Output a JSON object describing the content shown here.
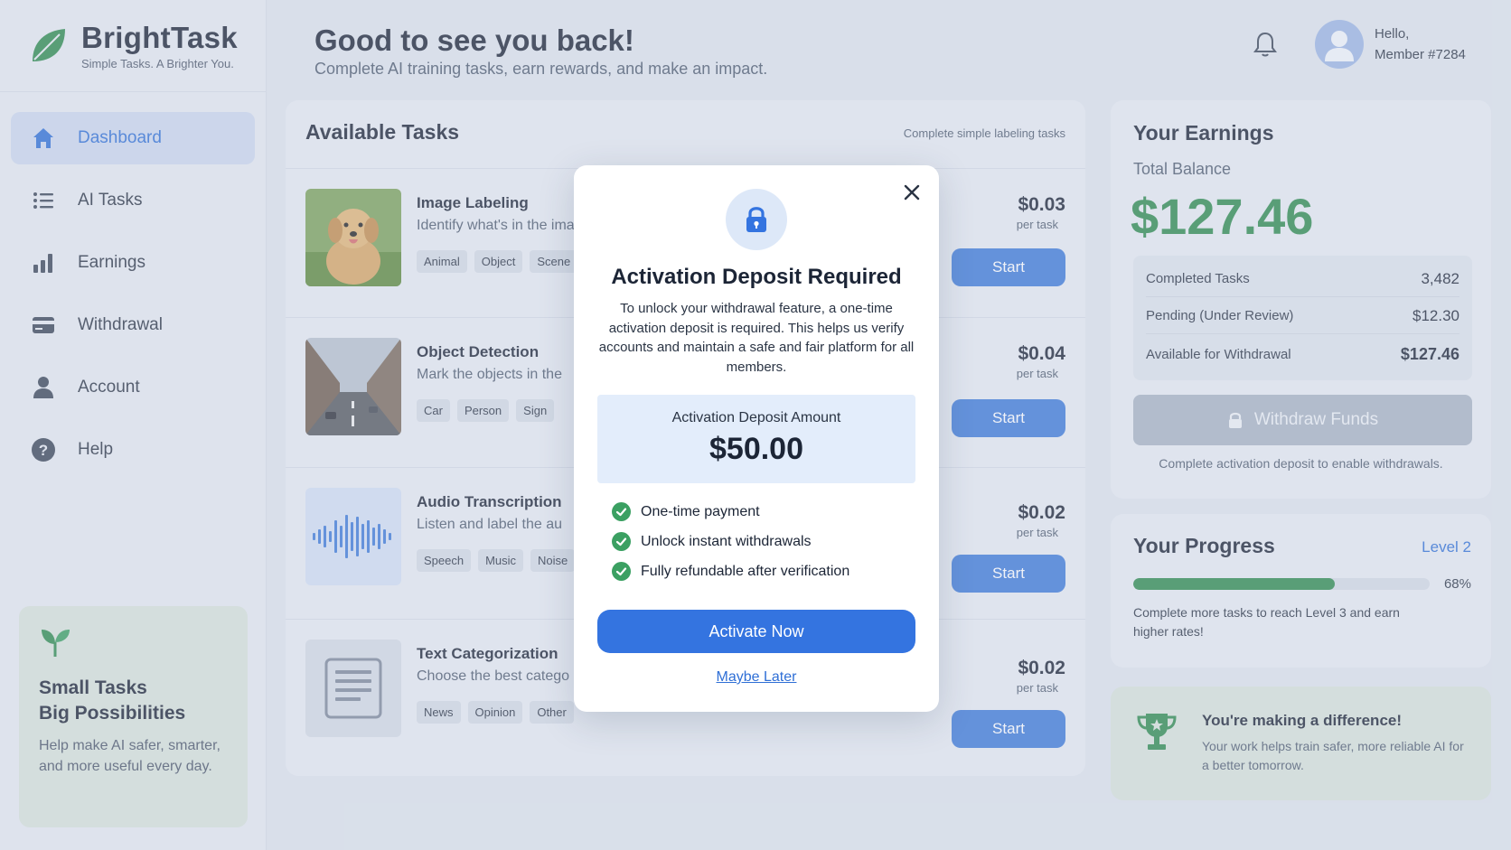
{
  "brand": {
    "name": "BrightTask",
    "tagline": "Simple Tasks. A Brighter You."
  },
  "sidebar": {
    "items": [
      {
        "label": "Dashboard",
        "icon": "home-icon",
        "active": true
      },
      {
        "label": "AI Tasks",
        "icon": "list-icon",
        "active": false
      },
      {
        "label": "Earnings",
        "icon": "bar-chart-icon",
        "active": false
      },
      {
        "label": "Withdrawal",
        "icon": "card-icon",
        "active": false
      },
      {
        "label": "Account",
        "icon": "user-icon",
        "active": false
      },
      {
        "label": "Help",
        "icon": "help-icon",
        "active": false
      }
    ],
    "promo": {
      "title_line1": "Small Tasks",
      "title_line2": "Big Possibilities",
      "text": "Help make AI safer, smarter, and more useful every day."
    }
  },
  "header": {
    "title": "Good to see you back!",
    "subtitle": "Complete AI training tasks, earn rewards, and make an impact.",
    "greeting_line1": "Hello,",
    "greeting_line2": "Member #7284"
  },
  "tasks": {
    "title": "Available Tasks",
    "note": "Complete simple labeling tasks",
    "items": [
      {
        "name": "Image Labeling",
        "desc": "Identify what's in the imag",
        "tags": [
          "Animal",
          "Object",
          "Scene"
        ],
        "price": "$0.03",
        "unit": "per task",
        "button": "Start"
      },
      {
        "name": "Object Detection",
        "desc": "Mark the objects in the",
        "tags": [
          "Car",
          "Person",
          "Sign"
        ],
        "price": "$0.04",
        "unit": "per task",
        "button": "Start"
      },
      {
        "name": "Audio Transcription",
        "desc": "Listen and label the au",
        "tags": [
          "Speech",
          "Music",
          "Noise"
        ],
        "price": "$0.02",
        "unit": "per task",
        "button": "Start"
      },
      {
        "name": "Text Categorization",
        "desc": "Choose the best catego",
        "tags": [
          "News",
          "Opinion",
          "Other"
        ],
        "price": "$0.02",
        "unit": "per task",
        "button": "Start"
      }
    ]
  },
  "earnings": {
    "title": "Your Earnings",
    "balance_label": "Total Balance",
    "balance": "$127.46",
    "stats": [
      {
        "label": "Completed Tasks",
        "value": "3,482"
      },
      {
        "label": "Pending (Under Review)",
        "value": "$12.30"
      },
      {
        "label": "Available for Withdrawal",
        "value": "$127.46"
      }
    ],
    "withdraw_button": "Withdraw Funds",
    "withdraw_note": "Complete activation deposit to enable withdrawals."
  },
  "progress": {
    "title": "Your Progress",
    "level": "Level 2",
    "percent_label": "68%",
    "percent": 0.68,
    "text": "Complete more tasks to reach Level 3 and earn higher rates!"
  },
  "difference": {
    "title": "You're making a difference!",
    "text": "Your work helps train safer, more reliable AI for a better tomorrow."
  },
  "modal": {
    "title": "Activation Deposit Required",
    "text": "To unlock your withdrawal feature, a one-time activation deposit is required. This helps us verify accounts and maintain a safe and fair platform for all members.",
    "deposit_label": "Activation Deposit Amount",
    "deposit_amount": "$50.00",
    "benefits": [
      "One-time payment",
      "Unlock instant withdrawals",
      "Fully refundable after verification"
    ],
    "primary_button": "Activate Now",
    "secondary_link": "Maybe Later"
  },
  "colors": {
    "accent": "#3474e0",
    "success": "#2e8b4e",
    "background": "#dfe5ee"
  }
}
